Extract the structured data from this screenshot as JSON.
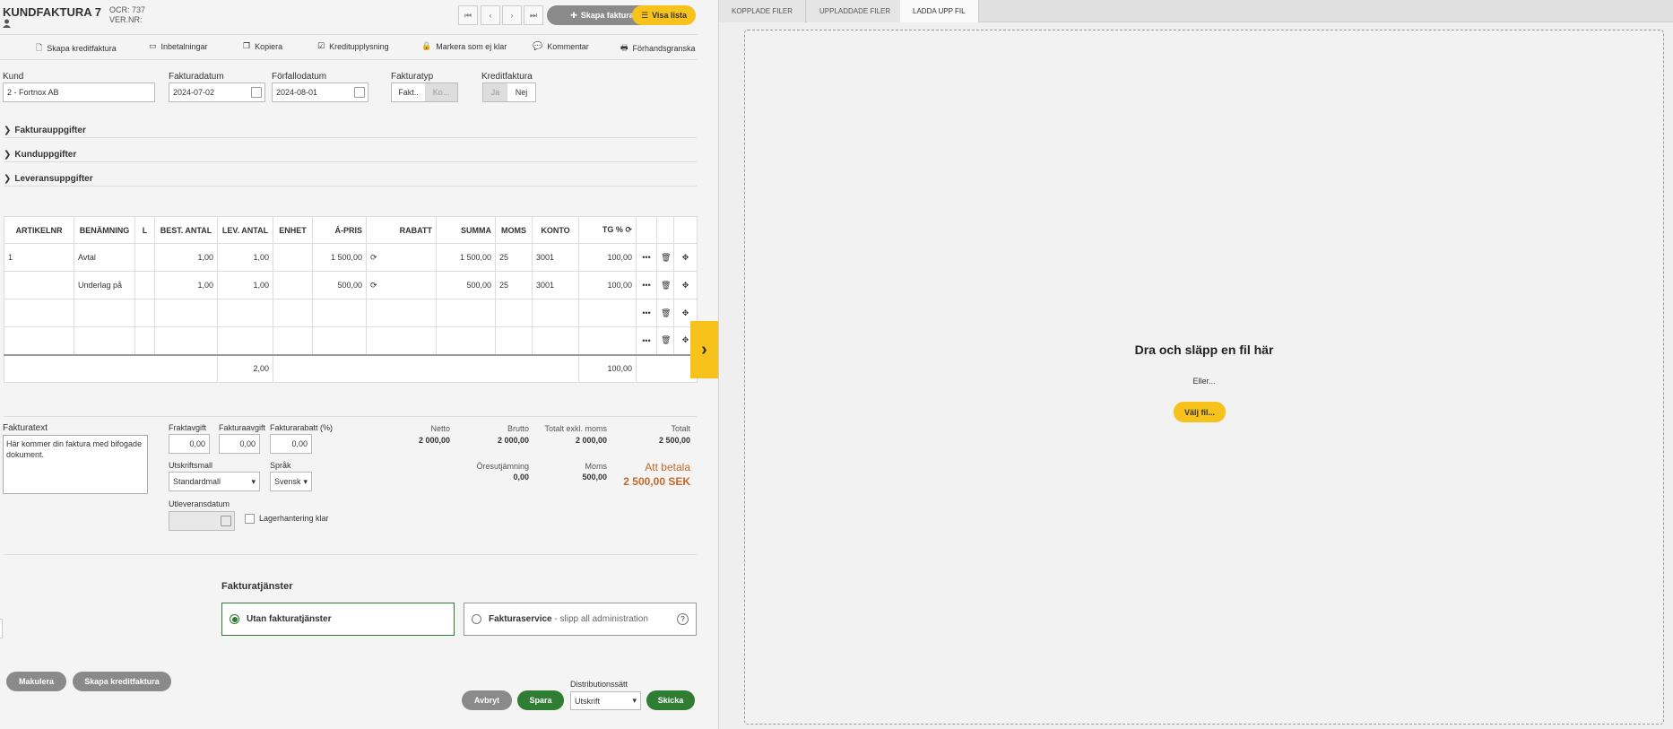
{
  "header": {
    "title": "KUNDFAKTURA 7",
    "ocr": "OCR: 737",
    "vernr": "VER.NR:",
    "nav": {
      "first": "⏮",
      "prev": "‹",
      "next": "›",
      "last": "⏭"
    },
    "create_invoice": "Skapa faktura",
    "show_list": "Visa lista"
  },
  "toolbar": [
    {
      "icon": "document-icon",
      "label": "Skapa kreditfaktura"
    },
    {
      "icon": "payments-icon",
      "label": "Inbetalningar"
    },
    {
      "icon": "copy-icon",
      "label": "Kopiera"
    },
    {
      "icon": "check-icon",
      "label": "Kreditupplysning"
    },
    {
      "icon": "lock-icon",
      "label": "Markera som ej klar"
    },
    {
      "icon": "comment-icon",
      "label": "Kommentar"
    },
    {
      "icon": "print-icon",
      "label": "Förhandsgranska"
    }
  ],
  "form": {
    "customer_label": "Kund",
    "customer_value": "2 - Fortnox AB",
    "invoice_date_label": "Fakturadatum",
    "invoice_date_value": "2024-07-02",
    "due_date_label": "Förfallodatum",
    "due_date_value": "2024-08-01",
    "invoice_type_label": "Fakturatyp",
    "invoice_type_opt1": "Fakt..",
    "invoice_type_opt2": "Ko...",
    "credit_label": "Kreditfaktura",
    "credit_yes": "Ja",
    "credit_no": "Nej"
  },
  "sections": [
    "Fakturauppgifter",
    "Kunduppgifter",
    "Leveransuppgifter"
  ],
  "table": {
    "headers": [
      "ARTIKELNR",
      "BENÄMNING",
      "L",
      "BEST. ANTAL",
      "LEV. ANTAL",
      "ENHET",
      "Á-PRIS",
      "RABATT",
      "SUMMA",
      "MOMS",
      "KONTO",
      "TG %"
    ],
    "rows": [
      {
        "artnr": "1",
        "name": "Avtal",
        "best": "1,00",
        "lev": "1,00",
        "enhet": "",
        "pris": "1 500,00",
        "rabatt": "",
        "summa": "1 500,00",
        "moms": "25",
        "konto": "3001",
        "tg": "100,00"
      },
      {
        "artnr": "",
        "name": "Underlag på",
        "best": "1,00",
        "lev": "1,00",
        "enhet": "",
        "pris": "500,00",
        "rabatt": "",
        "summa": "500,00",
        "moms": "25",
        "konto": "3001",
        "tg": "100,00"
      }
    ],
    "sum_lev": "2,00",
    "sum_tg": "100,00"
  },
  "bottom": {
    "text_label": "Fakturatext",
    "text_value": "Här kommer din faktura med bifogade dokument.",
    "freight_label": "Fraktavgift",
    "freight_value": "0,00",
    "fee_label": "Fakturaavgift",
    "fee_value": "0,00",
    "discount_label": "Fakturarabatt (%)",
    "discount_value": "0,00",
    "template_label": "Utskriftsmall",
    "template_value": "Standardmall",
    "lang_label": "Språk",
    "lang_value": "Svensk",
    "delivery_label": "Utleveransdatum",
    "stock_label": "Lagerhantering klar",
    "netto_label": "Netto",
    "netto_value": "2 000,00",
    "brutto_label": "Brutto",
    "brutto_value": "2 000,00",
    "exkl_label": "Totalt exkl. moms",
    "exkl_value": "2 000,00",
    "total_label": "Totalt",
    "total_value": "2 500,00",
    "rounding_label": "Öresutjämning",
    "rounding_value": "0,00",
    "vat_label": "Moms",
    "vat_value": "500,00",
    "pay_label": "Att betala",
    "pay_value": "2 500,00 SEK"
  },
  "services": {
    "heading": "Fakturatjänster",
    "opt1": "Utan fakturatjänster",
    "opt2": "Fakturaservice",
    "opt2_desc": " - slipp all administration"
  },
  "footer": {
    "scrap": "Makulera",
    "credit": "Skapa kreditfaktura",
    "cancel": "Avbryt",
    "save": "Spara",
    "dist_label": "Distributionssätt",
    "dist_value": "Utskrift",
    "send": "Skicka"
  },
  "right": {
    "tabs": [
      "KOPPLADE FILER",
      "UPPLADDADE FILER",
      "LADDA UPP FIL"
    ],
    "drop_title": "Dra och släpp en fil här",
    "or": "Eller...",
    "choose": "Välj fil..."
  },
  "colors": {
    "accent": "#f6c21b",
    "green": "#2e7d32",
    "pay": "#c0692a"
  }
}
